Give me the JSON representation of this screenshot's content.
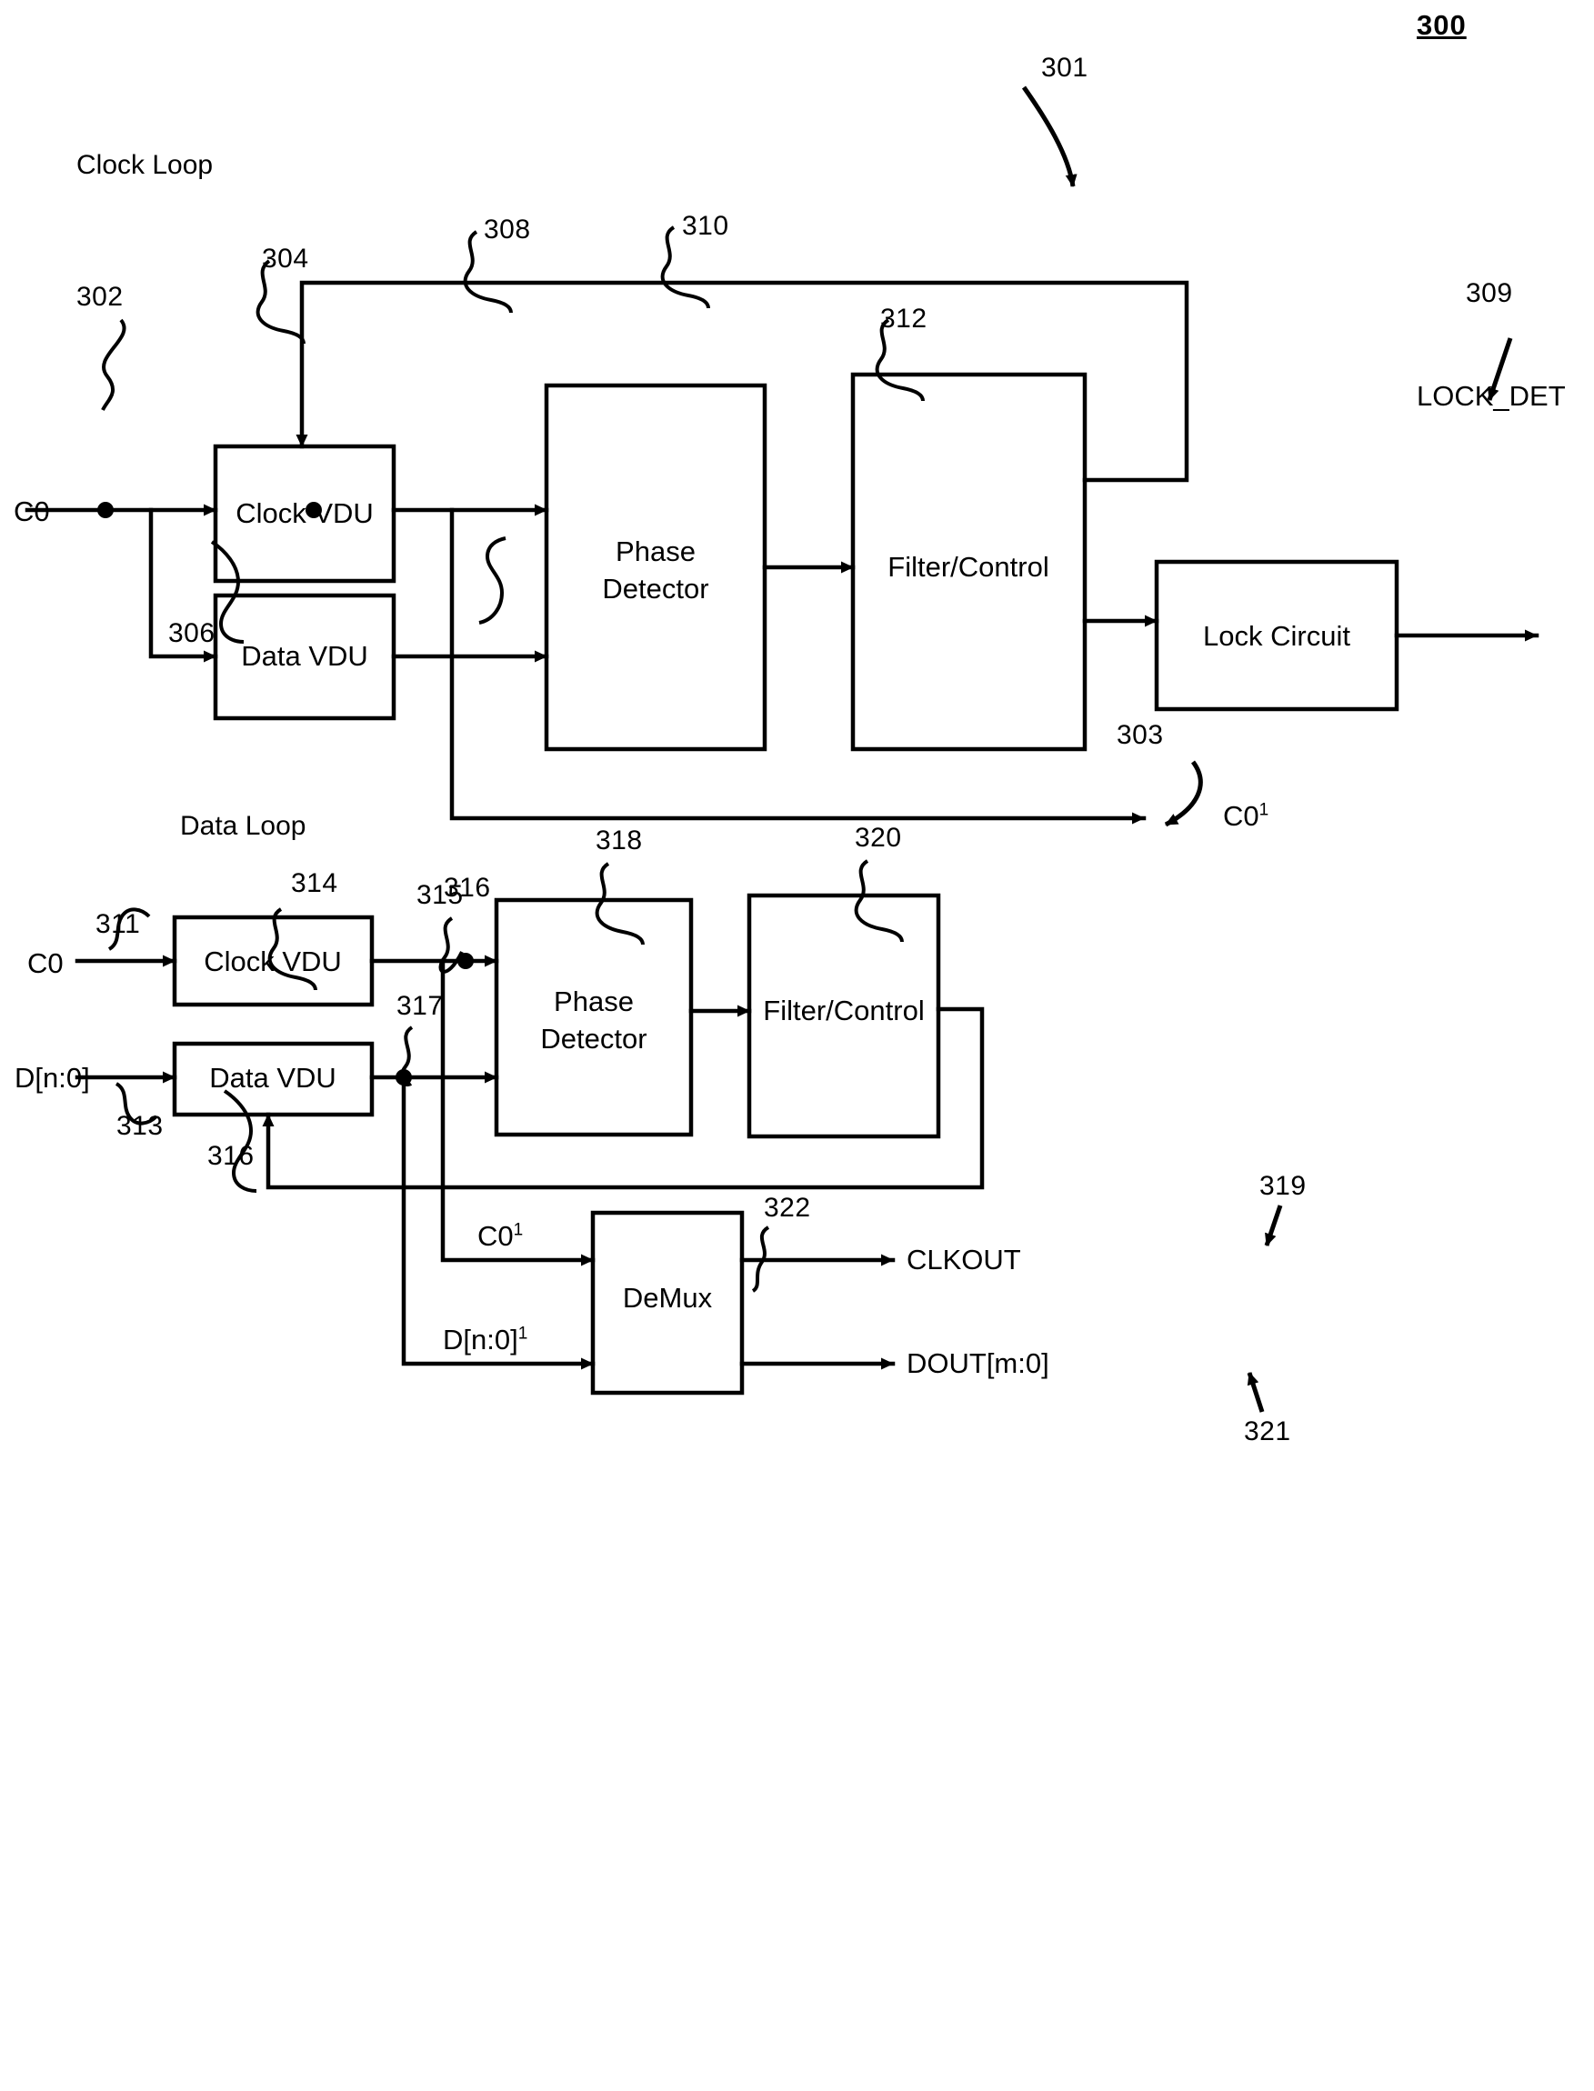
{
  "figure": {
    "number": "300",
    "title_hidden": ""
  },
  "sections": {
    "clock_loop": {
      "label": "Clock Loop",
      "ref": "301",
      "blocks": {
        "clock_vdu": {
          "label": "Clock VDU",
          "ref": "304"
        },
        "data_vdu": {
          "label": "Data VDU",
          "ref": "306"
        },
        "phase_detector": {
          "label_line1": "Phase",
          "label_line2": "Detector",
          "ref": "308"
        },
        "filter_control": {
          "label": "Filter/Control",
          "ref": "310"
        },
        "lock_circuit": {
          "label": "Lock Circuit",
          "ref": "312"
        }
      },
      "signals": {
        "input_clock": {
          "label": "C0",
          "ref": "302"
        },
        "lock_det_out": {
          "label": "LOCK_DET",
          "ref": "309"
        },
        "c0_prime_out": {
          "label": "C0",
          "sup": "1",
          "ref": "316"
        }
      }
    },
    "data_loop": {
      "label": "Data Loop",
      "ref": "303",
      "blocks": {
        "clock_vdu": {
          "label": "Clock VDU",
          "ref": "314"
        },
        "data_vdu": {
          "label": "Data VDU",
          "ref": "316"
        },
        "phase_detector": {
          "label_line1": "Phase",
          "label_line2": "Detector",
          "ref": "318"
        },
        "filter_control": {
          "label": "Filter/Control",
          "ref": "320"
        },
        "demux": {
          "label": "DeMux",
          "ref": "322"
        }
      },
      "signals": {
        "input_clock": {
          "label": "C0",
          "ref": "311"
        },
        "input_data": {
          "label": "D[n:0]",
          "ref": "313"
        },
        "clock_tap": {
          "ref": "315"
        },
        "data_tap": {
          "ref": "317"
        },
        "demux_clk_in": {
          "label": "C0",
          "sup": "1"
        },
        "demux_data_in": {
          "label": "D[n:0]",
          "sup": "1"
        },
        "clkout": {
          "label": "CLKOUT",
          "ref": "319"
        },
        "dout": {
          "label": "DOUT[m:0]",
          "ref": "321"
        }
      }
    }
  },
  "colors": {
    "ink": "#000000",
    "paper": "#ffffff"
  }
}
